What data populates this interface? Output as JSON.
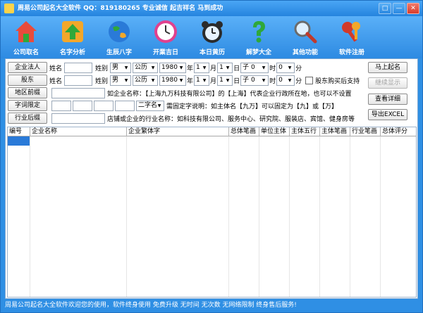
{
  "window": {
    "title": "周易公司起名大全软件   QQ：819180265   专业诚信 起吉祥名 马到成功",
    "buttons": [
      "□",
      "—",
      "✕"
    ]
  },
  "toolbar": {
    "items": [
      {
        "label": "公司取名",
        "icon": "house-icon",
        "color": "#e94b3c"
      },
      {
        "label": "名字分析",
        "icon": "up-arrow-icon",
        "color": "#f3a72a"
      },
      {
        "label": "生辰八字",
        "icon": "globe-icon",
        "color": "#2a7ad8"
      },
      {
        "label": "开業吉日",
        "icon": "clock-icon",
        "color": "#e0418e"
      },
      {
        "label": "本日黄历",
        "icon": "alarm-clock-icon",
        "color": "#2b2b2b"
      },
      {
        "label": "解梦大全",
        "icon": "question-icon",
        "color": "#2fa83a"
      },
      {
        "label": "其他功能",
        "icon": "magnifier-icon",
        "color": "#6b6b6b"
      },
      {
        "label": "软件注册",
        "icon": "keys-icon",
        "color": "#d23a2a"
      }
    ]
  },
  "form": {
    "row1": {
      "button": "企业法人",
      "name_label": "姓名",
      "surname_label": "姓别",
      "gender": "男",
      "calendar": "公历",
      "year": "1980",
      "year_unit": "年",
      "month": "1",
      "month_unit": "月",
      "day": "1",
      "day_unit": "日",
      "hour": "子 0",
      "hour_unit": "时",
      "minute": "0",
      "minute_unit": "分"
    },
    "row2": {
      "button": "股东",
      "name_label": "姓名",
      "surname_label": "姓别",
      "gender": "男",
      "calendar": "公历",
      "year": "1980",
      "year_unit": "年",
      "month": "1",
      "month_unit": "月",
      "day": "1",
      "day_unit": "日",
      "hour": "子 0",
      "hour_unit": "时",
      "minute": "0",
      "minute_unit": "分",
      "check_label": "股东购买后支持"
    },
    "row3": {
      "button": "地区前缀",
      "hint": "如企业名称：【上海九万科技有限公司】的【上海】代表企业行政所在地，也可以不设置"
    },
    "row4": {
      "button": "字词限定",
      "select": "二字名",
      "hint": "需固定字说明：如主体名【九万】可以固定为【九】或【万】"
    },
    "row5": {
      "button": "行业后缀",
      "hint": "店铺或企业的行业名称：如科技有限公司、服务中心、研究院、服装店、宾馆、健身房等"
    },
    "side_buttons": {
      "start": "马上起名",
      "continue": "继续显示",
      "details": "查看详细",
      "export": "导出EXCEL"
    }
  },
  "grid": {
    "columns": [
      "编号",
      "企业名称",
      "企业繁体字",
      "总体笔画",
      "单位主体",
      "主体五行",
      "主体笔画",
      "行业笔画",
      "总体评分"
    ]
  },
  "status": {
    "text": "周易公司起名大全软件欢迎您的使用，软件终身使用 免费升级 无时间  无次数  无网络限制 终身售后服务!"
  }
}
